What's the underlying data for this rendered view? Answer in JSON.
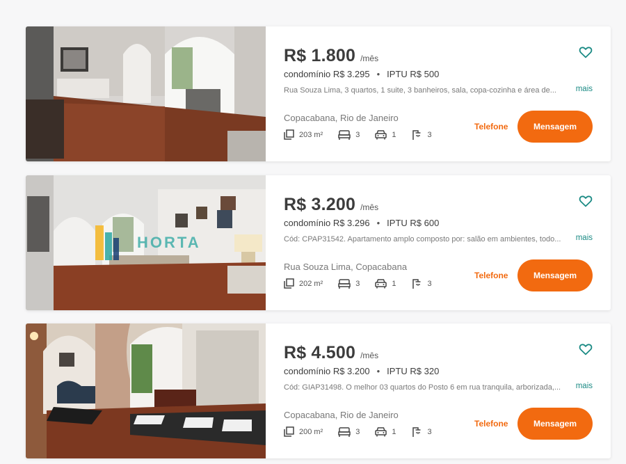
{
  "listings": [
    {
      "price": "R$ 1.800",
      "period": "/mês",
      "condo": "condomínio R$ 3.295",
      "separator": "•",
      "iptu": "IPTU R$ 500",
      "description": "Rua Souza Lima, 3 quartos, 1 suite, 3 banheiros, sala, copa-cozinha e área de...",
      "more_label": "mais",
      "address": "Copacabana, Rio de Janeiro",
      "area": "203 m²",
      "bedrooms": "3",
      "parking": "1",
      "bathrooms": "3",
      "phone_label": "Telefone",
      "message_label": "Mensagem"
    },
    {
      "price": "R$ 3.200",
      "period": "/mês",
      "condo": "condomínio R$ 3.296",
      "separator": "•",
      "iptu": "IPTU R$ 600",
      "description": "Cód: CPAP31542. Apartamento amplo composto por: salão em ambientes, todo...",
      "more_label": "mais",
      "address": "Rua Souza Lima, Copacabana",
      "area": "202 m²",
      "bedrooms": "3",
      "parking": "1",
      "bathrooms": "3",
      "phone_label": "Telefone",
      "message_label": "Mensagem",
      "watermark": "HORTA"
    },
    {
      "price": "R$ 4.500",
      "period": "/mês",
      "condo": "condomínio R$ 3.200",
      "separator": "•",
      "iptu": "IPTU R$ 320",
      "description": "Cód: GIAP31498. O melhor 03 quartos do Posto 6 em rua tranquila, arborizada,...",
      "more_label": "mais",
      "address": "Copacabana, Rio de Janeiro",
      "area": "200 m²",
      "bedrooms": "3",
      "parking": "1",
      "bathrooms": "3",
      "phone_label": "Telefone",
      "message_label": "Mensagem"
    }
  ],
  "icons": {
    "favorite": "heart-outline-icon",
    "area": "area-icon",
    "bedrooms": "bed-icon",
    "parking": "car-icon",
    "bathrooms": "shower-icon"
  },
  "colors": {
    "accent": "#f26a10",
    "link": "#1a8a84",
    "price": "#3c3c3c"
  }
}
